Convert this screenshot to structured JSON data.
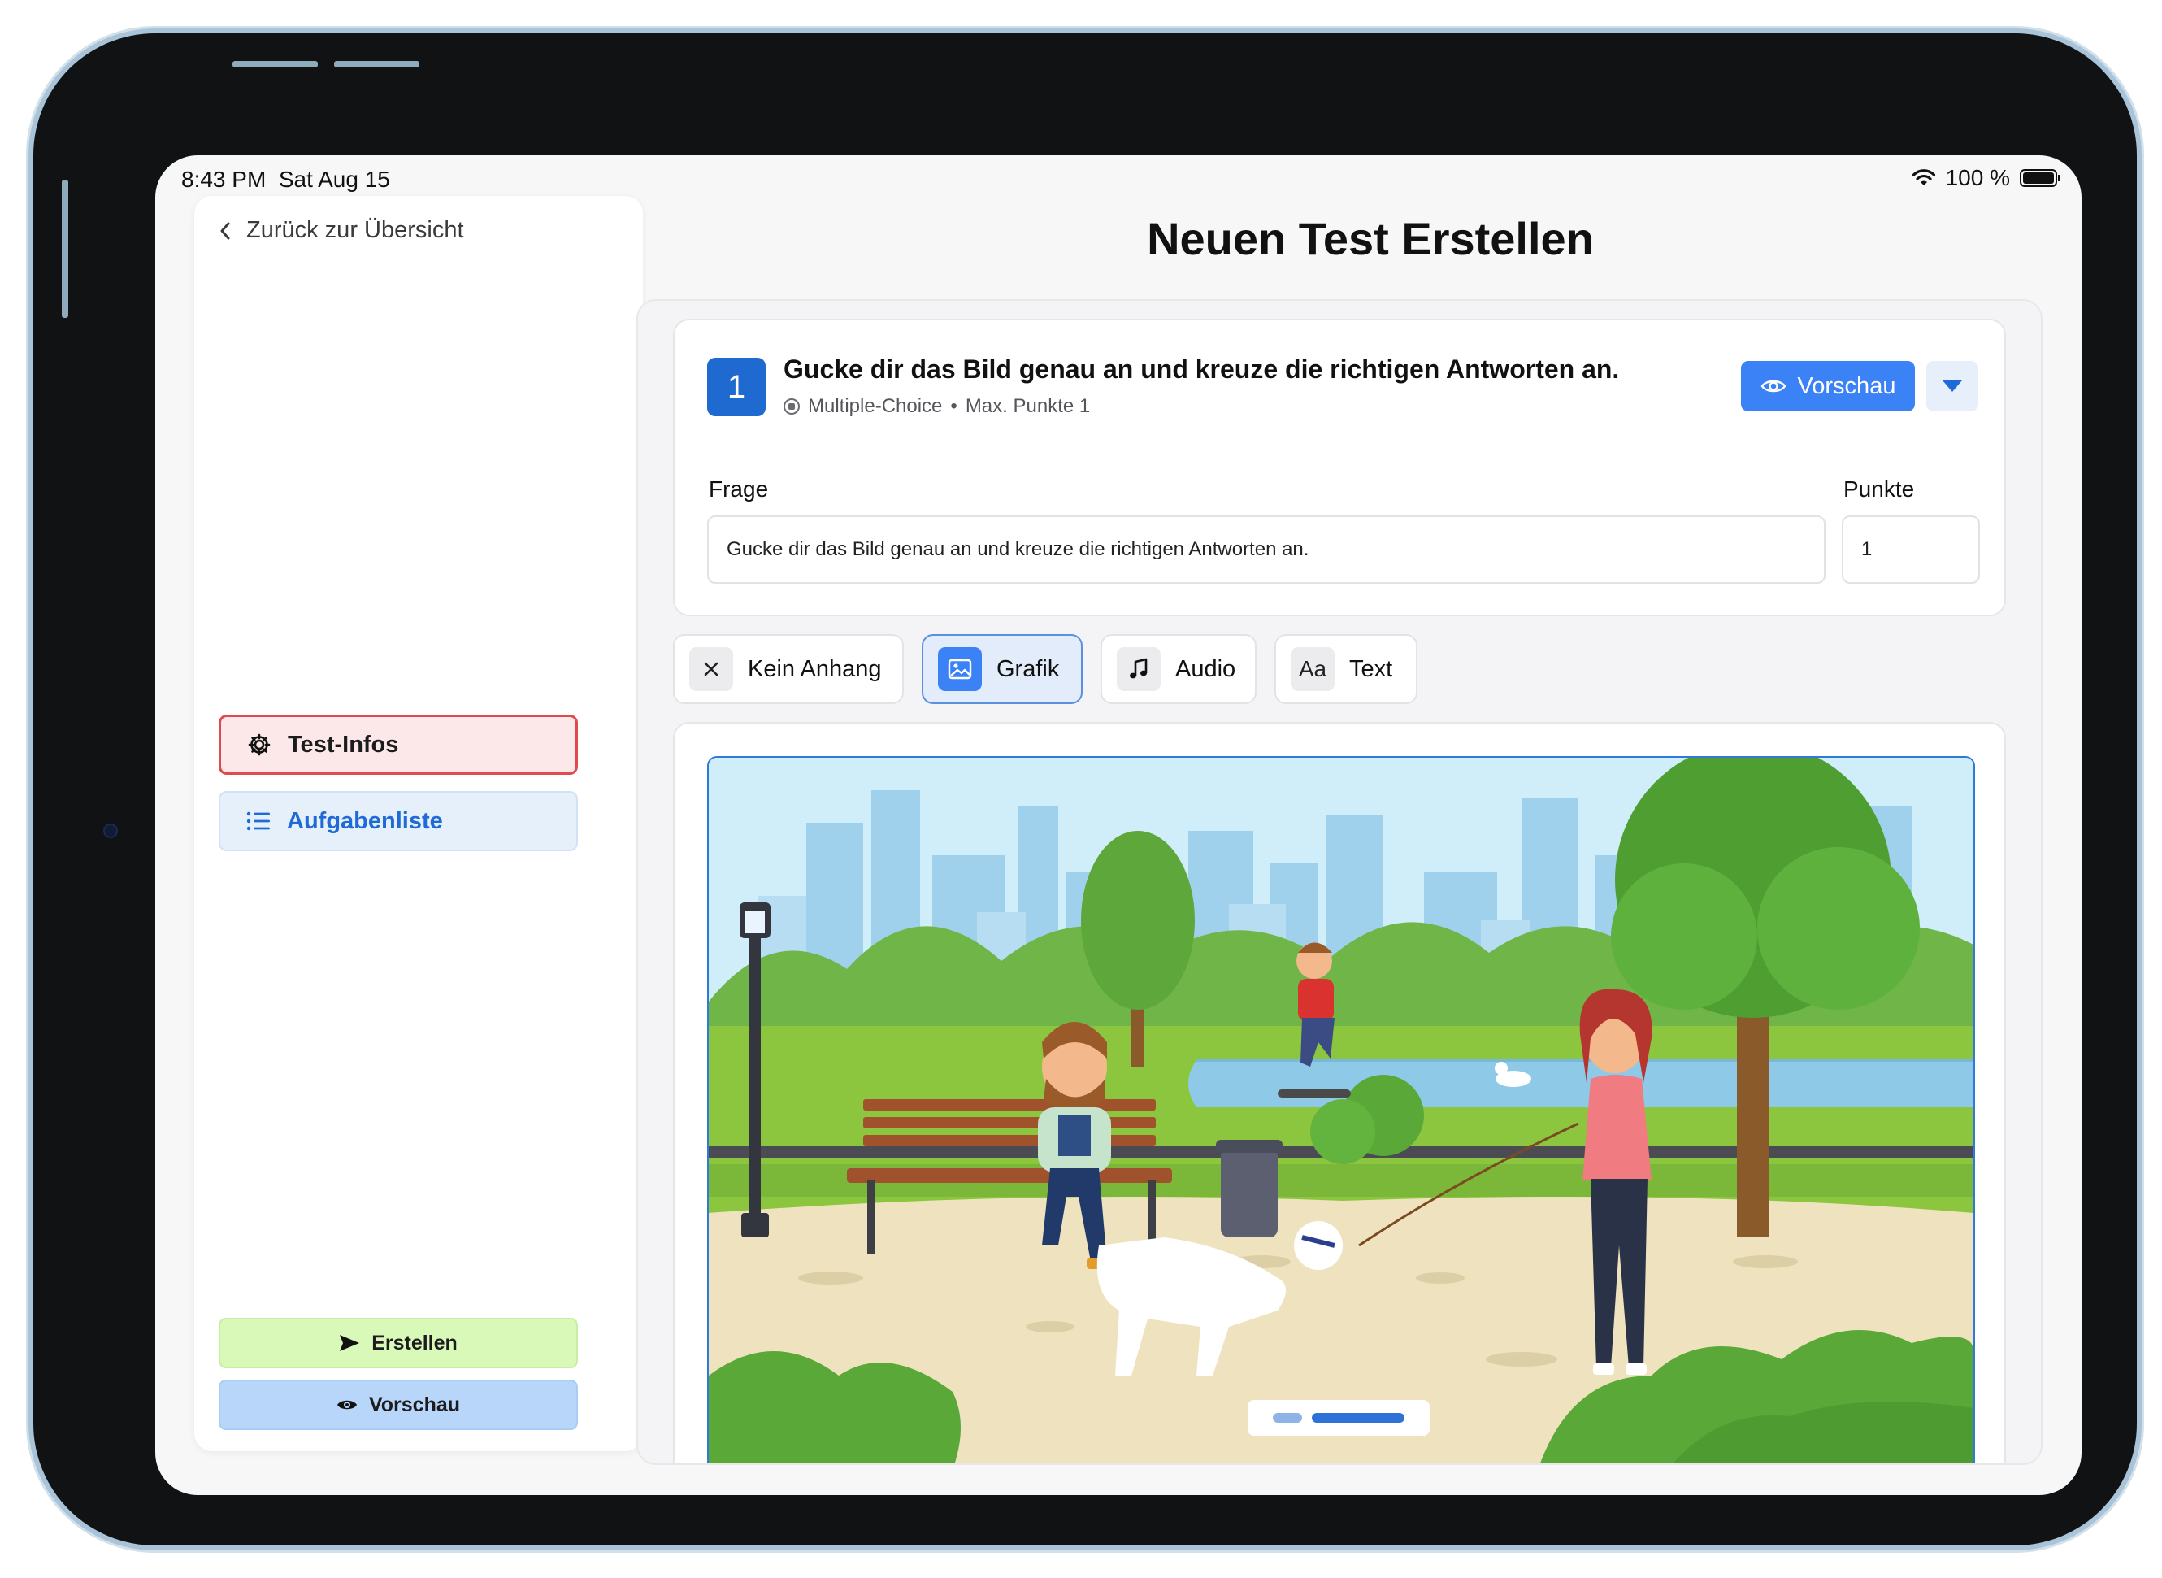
{
  "status_bar": {
    "time": "8:43 PM",
    "date": "Sat Aug 15",
    "battery": "100 %"
  },
  "sidebar": {
    "back_label": "Zurück zur Übersicht",
    "nav": [
      {
        "label": "Test-Infos",
        "icon": "gear-icon",
        "active": true
      },
      {
        "label": "Aufgabenliste",
        "icon": "list-icon",
        "active": false
      }
    ],
    "create_label": "Erstellen",
    "preview_label": "Vorschau"
  },
  "page": {
    "title": "Neuen Test Erstellen"
  },
  "question": {
    "number": "1",
    "title": "Gucke dir das Bild genau an und kreuze die richtigen Antworten an.",
    "type": "Multiple-Choice",
    "separator": "•",
    "max_points": "Max. Punkte 1",
    "preview_label": "Vorschau",
    "frage_label": "Frage",
    "frage_value": "Gucke dir das Bild genau an und kreuze die richtigen Antworten an.",
    "punkte_label": "Punkte",
    "punkte_value": "1"
  },
  "attachments": [
    {
      "label": "Kein Anhang",
      "icon": "x-icon",
      "active": false
    },
    {
      "label": "Grafik",
      "icon": "image-icon",
      "active": true
    },
    {
      "label": "Audio",
      "icon": "music-note-icon",
      "active": false
    },
    {
      "label": "Text",
      "icon": "text-aa-icon",
      "icon_text": "Aa",
      "active": false
    }
  ],
  "image_pager": {
    "count": 2,
    "active_index": 1
  },
  "colors": {
    "primary_blue": "#3b82f6",
    "active_red": "#e04a4f",
    "create_green": "#d9f9b8",
    "preview_blue": "#b7d6f9"
  }
}
